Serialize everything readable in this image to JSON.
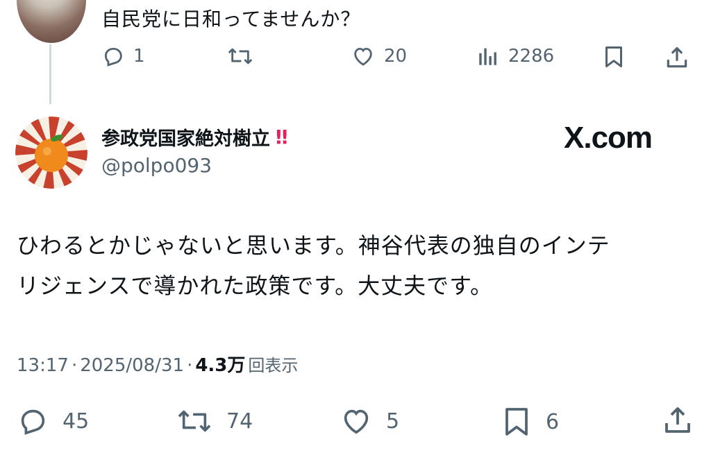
{
  "reply": {
    "text": "自民党に日和ってませんか？",
    "actions": {
      "reply_count": "1",
      "repost_count": "",
      "like_count": "20",
      "view_count": "2286"
    }
  },
  "tweet": {
    "display_name": "参政党国家絶対樹立",
    "badge": "!!",
    "handle": "@polpo093",
    "brand": "X.com",
    "body_line1": "ひわるとかじゃないと思います。神谷代表の独自のインテ",
    "body_line2": "リジェンスで導かれた政策です。大丈夫です。",
    "time": "13:17",
    "date": "2025/08/31",
    "separator": "·",
    "views_number": "4.3万",
    "views_suffix": "回表示",
    "actions": {
      "reply_count": "45",
      "repost_count": "74",
      "like_count": "5",
      "bookmark_count": "6"
    }
  },
  "colors": {
    "text": "#0f1419",
    "secondary": "#536471",
    "badge": "#e0245e",
    "thread_line": "#cfd9de"
  },
  "icons": [
    "reply-icon",
    "repost-icon",
    "like-icon",
    "views-icon",
    "bookmark-icon",
    "share-icon"
  ]
}
